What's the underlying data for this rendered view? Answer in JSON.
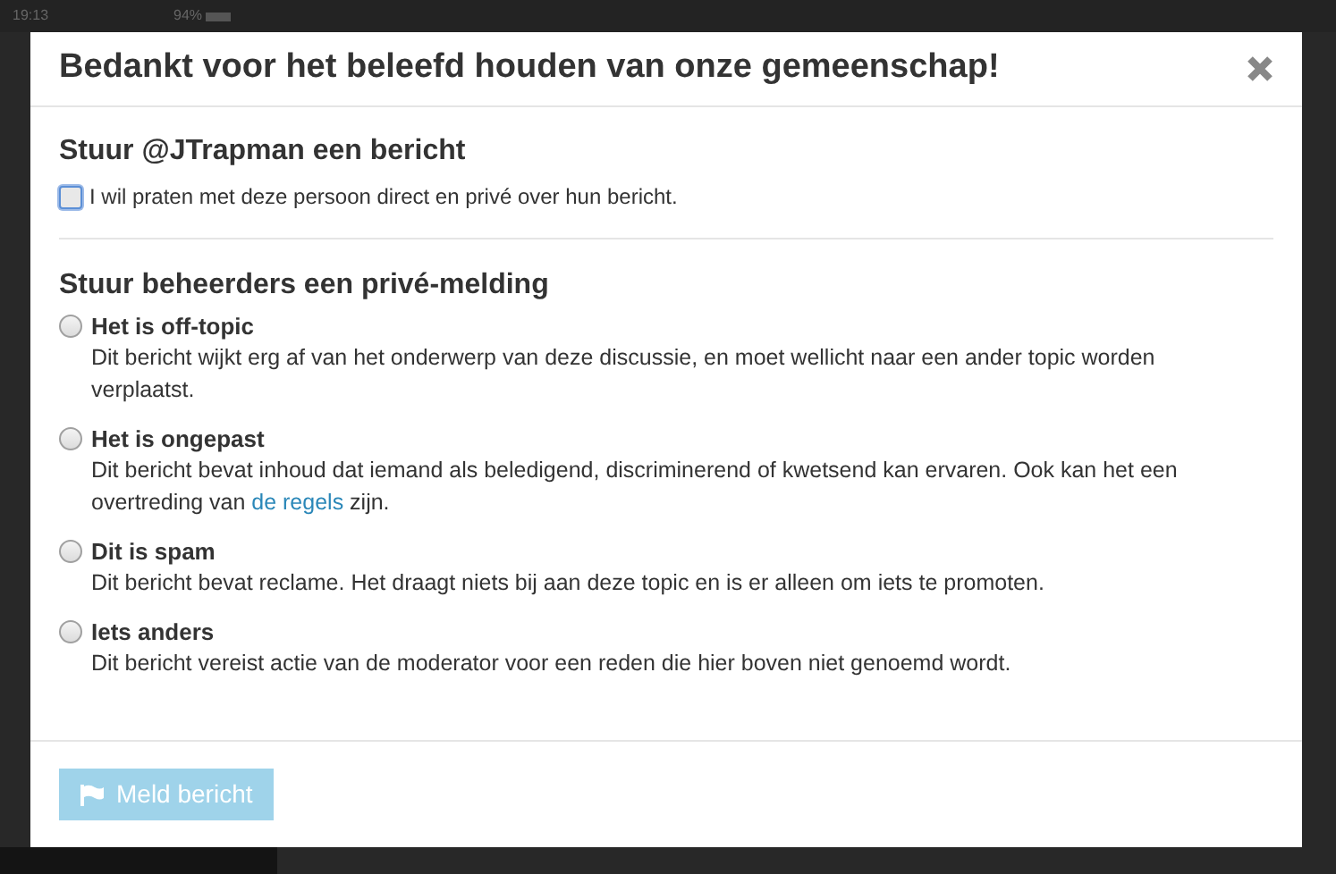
{
  "status_bar": {
    "time": "19:13",
    "battery": "94%"
  },
  "dialog": {
    "title": "Bedankt voor het beleefd houden van onze gemeenschap!",
    "message_section": {
      "heading": "Stuur @JTrapman een bericht",
      "checkbox": {
        "label": "I wil praten met deze persoon direct en privé over hun bericht.",
        "checked": false,
        "focused": true
      }
    },
    "flag_section": {
      "heading": "Stuur beheerders een privé-melding",
      "options": [
        {
          "title": "Het is off-topic",
          "selected": false,
          "parts": [
            {
              "kind": "text",
              "text": "Dit bericht wijkt erg af van het onderwerp van deze discussie, en moet wellicht naar een ander topic worden verplaatst."
            }
          ]
        },
        {
          "title": "Het is ongepast",
          "selected": false,
          "parts": [
            {
              "kind": "text",
              "text": "Dit bericht bevat inhoud dat iemand als beledigend, discriminerend of kwetsend kan ervaren. Ook kan het een overtreding van "
            },
            {
              "kind": "link",
              "text": "de regels"
            },
            {
              "kind": "text",
              "text": " zijn."
            }
          ]
        },
        {
          "title": "Dit is spam",
          "selected": false,
          "parts": [
            {
              "kind": "text",
              "text": "Dit bericht bevat reclame. Het draagt niets bij aan deze topic en is er alleen om iets te promoten."
            }
          ]
        },
        {
          "title": "Iets anders",
          "selected": false,
          "parts": [
            {
              "kind": "text",
              "text": "Dit bericht vereist actie van de moderator voor een reden die hier boven niet genoemd wordt."
            }
          ]
        }
      ]
    },
    "submit_button": {
      "label": "Meld bericht",
      "disabled": true
    }
  }
}
